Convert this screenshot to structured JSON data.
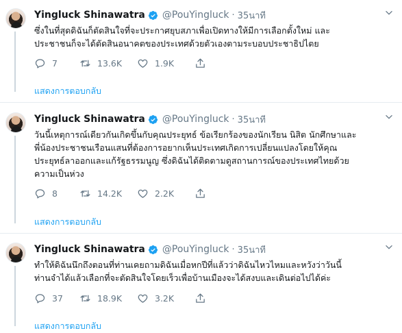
{
  "tweets": [
    {
      "author_name": "Yingluck Shinawatra",
      "handle": "@PouYingluck",
      "time": "35นาที",
      "text": "ซึ่งในที่สุดดิฉันก็ตัดสินใจที่จะประกาศยุบสภาเพื่อเปิดทางให้มีการเลือกตั้งใหม่  และ\nประชาชนก็จะได้ตัดสินอนาคตของประเทศด้วยตัวเองตามระบอบประชาธิปไตย",
      "replies": "7",
      "retweets": "13.6K",
      "likes": "1.9K",
      "show_replies": "แสดงการตอบกลับ"
    },
    {
      "author_name": "Yingluck Shinawatra",
      "handle": "@PouYingluck",
      "time": "35นาที",
      "text": "วันนี้เหตุการณ์เดียวกันเกิดขึ้นกับคุณประยุทธ์ ข้อเรียกร้องของนักเรียน นิสิต นักศึกษาและ\nพี่น้องประชาชนเรือนแสนที่ต้องการอยากเห็นประเทศเกิดการเปลี่ยนแปลงโดยให้คุณ\nประยุทธ์ลาออกและแก้รัฐธรรมนูญ ซึ่งดิฉันได้ติดตามดูสถานการณ์ของประเทศไทยด้วย\nความเป็นห่วง",
      "replies": "8",
      "retweets": "14.2K",
      "likes": "2.2K",
      "show_replies": "แสดงการตอบกลับ"
    },
    {
      "author_name": "Yingluck Shinawatra",
      "handle": "@PouYingluck",
      "time": "35นาที",
      "text": "ทำให้ดิฉันนึกถึงตอนที่ท่านเคยถามดิฉันเมื่อหกปีที่แล้วว่าดิฉันไหวไหมและหวังว่าวันนี้\nท่านจำได้แล้วเลือกที่จะตัดสินใจโดยเร็วเพื่อบ้านเมืองจะได้สงบและเดินต่อไปได้ค่ะ",
      "replies": "37",
      "retweets": "18.9K",
      "likes": "3.2K",
      "show_replies": "แสดงการตอบกลับ"
    }
  ],
  "icons": {
    "verified": "verified-badge-icon",
    "caret": "chevron-down-icon",
    "reply": "reply-icon",
    "retweet": "retweet-icon",
    "like": "heart-icon",
    "share": "share-icon"
  },
  "colors": {
    "link": "#1da1f2",
    "secondary": "#657786",
    "thread_line": "#ccd6dd"
  }
}
